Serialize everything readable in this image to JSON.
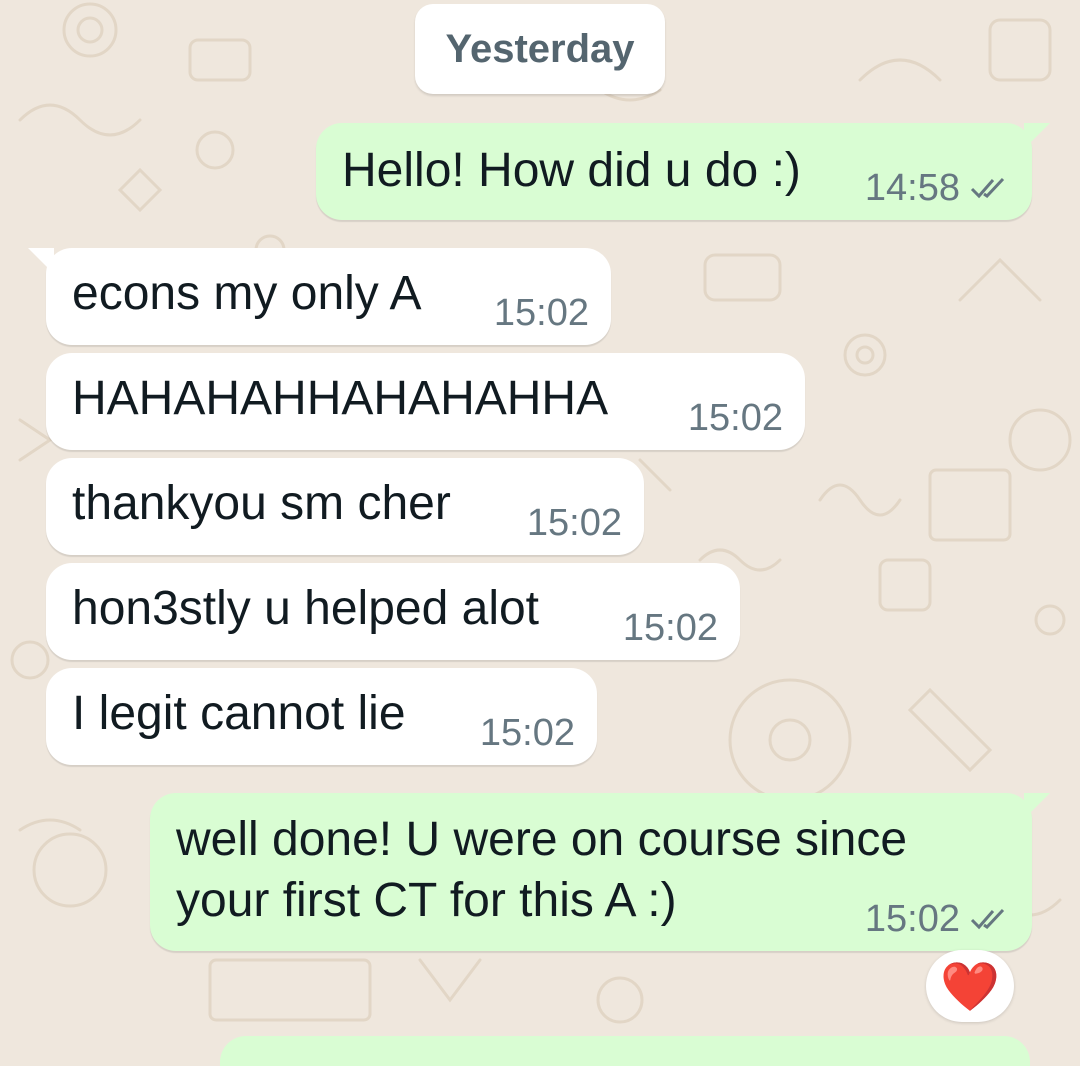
{
  "date_separator": "Yesterday",
  "messages": [
    {
      "direction": "outgoing",
      "text": "Hello! How did u do :)",
      "time": "14:58",
      "status": "read"
    },
    {
      "direction": "incoming",
      "text": "econs my only A",
      "time": "15:02"
    },
    {
      "direction": "incoming",
      "text": "HAHAHAHHAHAHAHHA",
      "time": "15:02"
    },
    {
      "direction": "incoming",
      "text": "thankyou sm cher",
      "time": "15:02"
    },
    {
      "direction": "incoming",
      "text": "hon3stly u helped alot",
      "time": "15:02"
    },
    {
      "direction": "incoming",
      "text": "I legit cannot lie",
      "time": "15:02"
    },
    {
      "direction": "outgoing",
      "text_lines": [
        "well done! U were on course since",
        "your first CT for this A :)"
      ],
      "time": "15:02",
      "status": "read",
      "reaction": "❤️"
    }
  ],
  "colors": {
    "background": "#efe7dd",
    "incoming_bubble": "#ffffff",
    "outgoing_bubble": "#d9fdd3",
    "text": "#111b21",
    "meta": "#667781",
    "read_ticks": "#667781"
  },
  "icons": {
    "read_receipt": "double-check-icon",
    "reaction": "red-heart-icon"
  }
}
